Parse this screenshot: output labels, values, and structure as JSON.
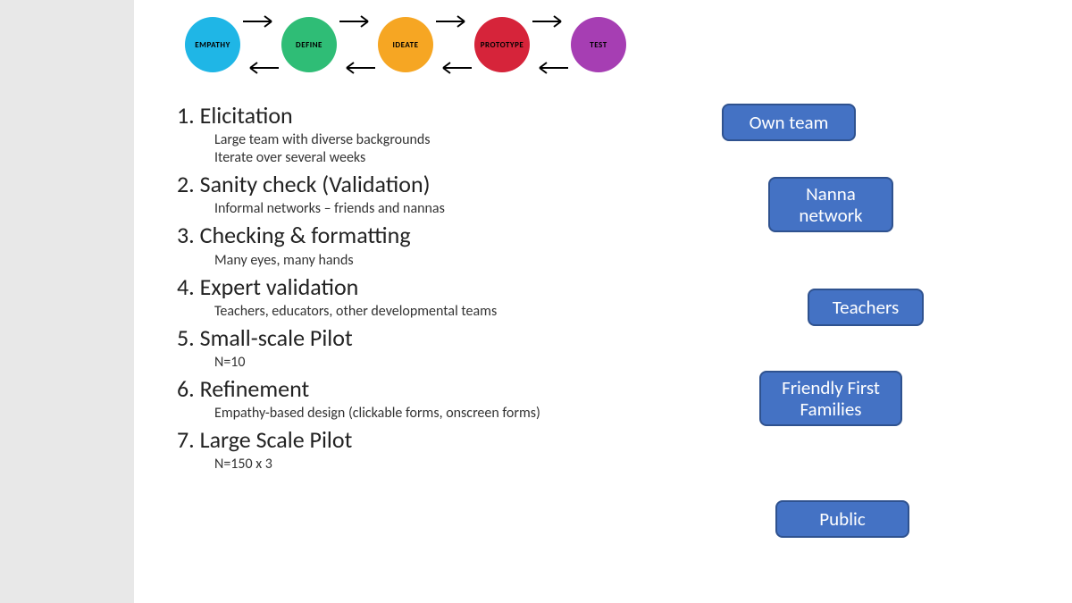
{
  "process": {
    "stages": [
      {
        "label": "EMPATHY",
        "colorClass": "c-empathy"
      },
      {
        "label": "DEFINE",
        "colorClass": "c-define"
      },
      {
        "label": "IDEATE",
        "colorClass": "c-ideate"
      },
      {
        "label": "PROTOTYPE",
        "colorClass": "c-prototype"
      },
      {
        "label": "TEST",
        "colorClass": "c-test"
      }
    ]
  },
  "steps": [
    {
      "num": "1.",
      "title": "Elicitation",
      "subs": [
        "Large team with diverse backgrounds",
        "Iterate over several weeks"
      ]
    },
    {
      "num": "2.",
      "title": "Sanity check (Validation)",
      "subs": [
        " Informal networks – friends and nannas"
      ]
    },
    {
      "num": "3.",
      "title": "Checking & formatting",
      "subs": [
        "Many eyes, many hands"
      ]
    },
    {
      "num": "4.",
      "title": "Expert validation",
      "subs": [
        "Teachers, educators, other developmental teams"
      ]
    },
    {
      "num": "5.",
      "title": "Small-scale Pilot",
      "subs": [
        "N=10"
      ]
    },
    {
      "num": "6.",
      "title": "Refinement",
      "subs": [
        "Empathy-based design (clickable forms, onscreen forms)"
      ]
    },
    {
      "num": "7.",
      "title": "Large Scale Pilot",
      "subs": [
        "N=150 x 3"
      ]
    }
  ],
  "boxes": {
    "b1": "Own team",
    "b2": "Nanna network",
    "b3": "Teachers",
    "b4": "Friendly First Families",
    "b5": "Public"
  }
}
